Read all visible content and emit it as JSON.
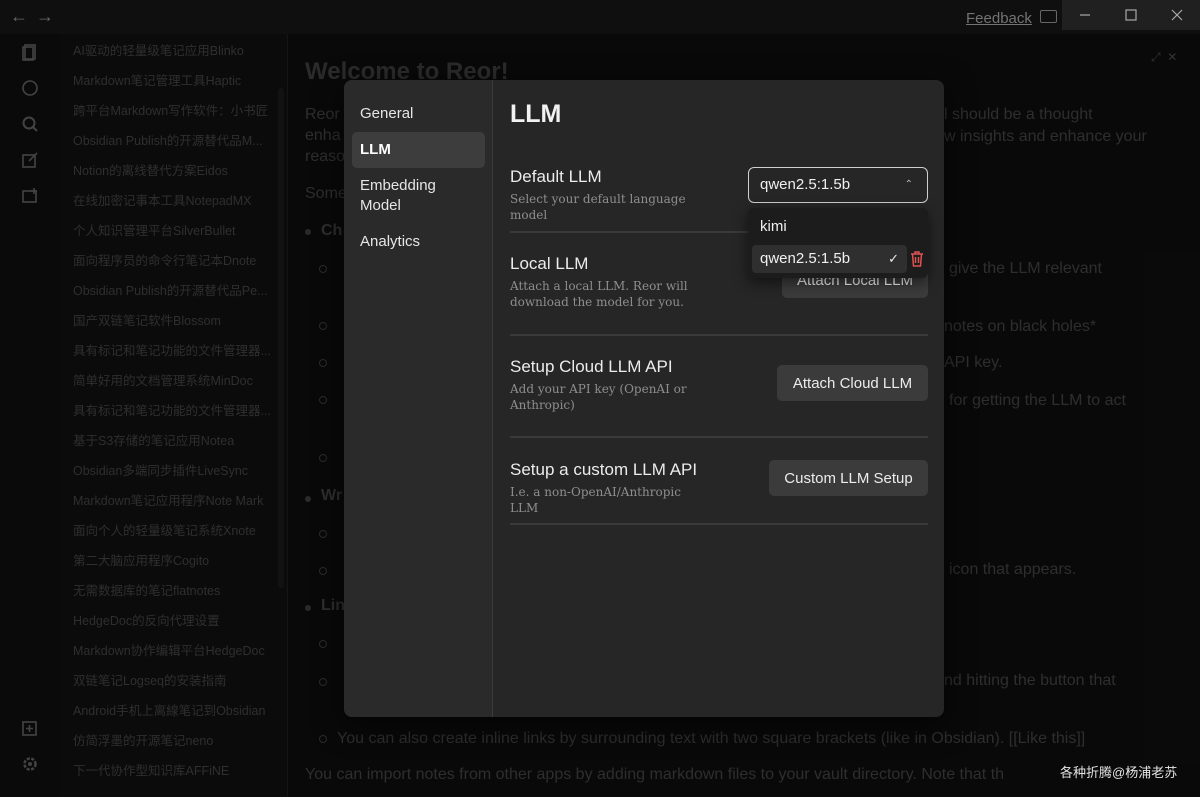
{
  "titlebar": {
    "feedback_label": "Feedback",
    "back_icon": "arrow-left-icon",
    "forward_icon": "arrow-right-icon"
  },
  "sidebar_files": [
    "AI驱动的轻量级笔记应用Blinko",
    "Markdown笔记管理工具Haptic",
    "跨平台Markdown写作软件：小书匠",
    "Obsidian Publish的开源替代品M...",
    "Notion的离线替代方案Eidos",
    "在线加密记事本工具NotepadMX",
    "个人知识管理平台SilverBullet",
    "面向程序员的命令行笔记本Dnote",
    "Obsidian Publish的开源替代品Pe...",
    "国产双链笔记软件Blossom",
    "具有标记和笔记功能的文件管理器...",
    "简单好用的文档管理系统MinDoc",
    "具有标记和笔记功能的文件管理器...",
    "基于S3存储的笔记应用Notea",
    "Obsidian多端同步插件LiveSync",
    "Markdown笔记应用程序Note Mark",
    "面向个人的轻量级笔记系统Xnote",
    "第二大脑应用程序Cogito",
    "无需数据库的笔记flatnotes",
    "HedgeDoc的反向代理设置",
    "Markdown协作编辑平台HedgeDoc",
    "双链笔记Logseq的安装指南",
    "Android手机上离線笔记到Obsidian",
    "仿简浮墨的开源笔记neno",
    "下一代协作型知识库AFFiNE"
  ],
  "background_doc": {
    "title": "Welcome to Reor!",
    "lines": [
      "Reor",
      "enha",
      "reaso",
      "Some",
      "Ch",
      "give the LLM relevant",
      "notes on black holes*",
      "API key.",
      "for getting the LLM to act",
      "Wr",
      "icon that appears.",
      "Lin",
      "nd hitting the button that",
      "You can also create inline links by surrounding text with two square brackets (like in Obsidian). [[Like this]]",
      "You can import notes from other apps by adding markdown files to your vault directory. Note that th",
      "l should be a thought",
      "w insights and enhance your"
    ]
  },
  "settings": {
    "nav": [
      "General",
      "LLM",
      "Embedding Model",
      "Analytics"
    ],
    "active_nav": "LLM",
    "page_title": "LLM",
    "default_llm": {
      "title": "Default LLM",
      "desc": "Select your default language model",
      "selected": "qwen2.5:1.5b",
      "options": [
        "kimi",
        "qwen2.5:1.5b"
      ]
    },
    "local_llm": {
      "title": "Local LLM",
      "desc": "Attach a local LLM. Reor will download the model for you.",
      "button": "Attach Local LLM"
    },
    "cloud_llm": {
      "title": "Setup Cloud LLM API",
      "desc": "Add your API key (OpenAI or Anthropic)",
      "button": "Attach Cloud LLM"
    },
    "custom_llm": {
      "title": "Setup a custom LLM API",
      "desc": "I.e. a non-OpenAI/Anthropic LLM",
      "button": "Custom LLM Setup"
    }
  },
  "watermark": "各种折腾@杨浦老苏",
  "colors": {
    "accent_delete": "#e05252",
    "modal_bg": "#262626"
  }
}
